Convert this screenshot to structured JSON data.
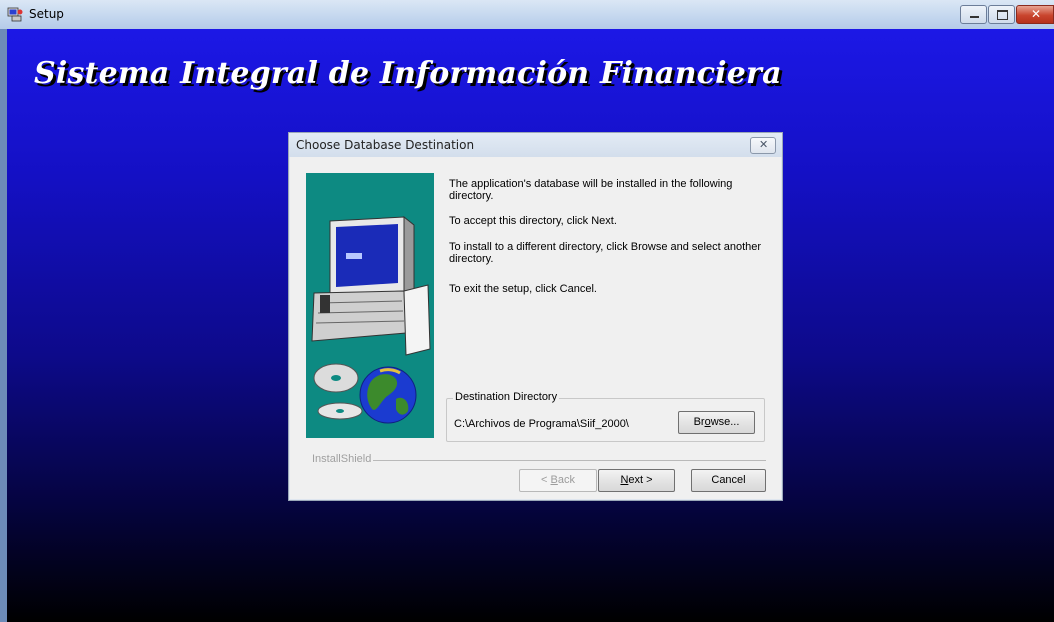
{
  "window": {
    "title": "Setup",
    "banner": "Sistema Integral de Información Financiera"
  },
  "dialog": {
    "title": "Choose Database Destination",
    "close_glyph": "✕",
    "paragraphs": [
      "The application's database will be installed in the following directory.",
      "To accept this directory, click Next.",
      "To install to a different directory, click Browse and select another directory.",
      "To exit the setup,  click Cancel."
    ],
    "group": {
      "legend": "Destination Directory",
      "path": "C:\\Archivos de Programa\\Siif_2000\\"
    },
    "brand": "InstallShield",
    "buttons": {
      "browse_pre": "Br",
      "browse_hot": "o",
      "browse_post": "wse...",
      "back_pre": "< ",
      "back_hot": "B",
      "back_post": "ack",
      "next_hot": "N",
      "next_post": "ext >",
      "cancel": "Cancel"
    }
  },
  "colors": {
    "client_top": "#1c18e6",
    "client_bottom": "#000000",
    "art_bg": "#0d8a82"
  },
  "icons": {
    "app": "setup-computer-icon",
    "art": "computer-and-globe-illustration"
  }
}
